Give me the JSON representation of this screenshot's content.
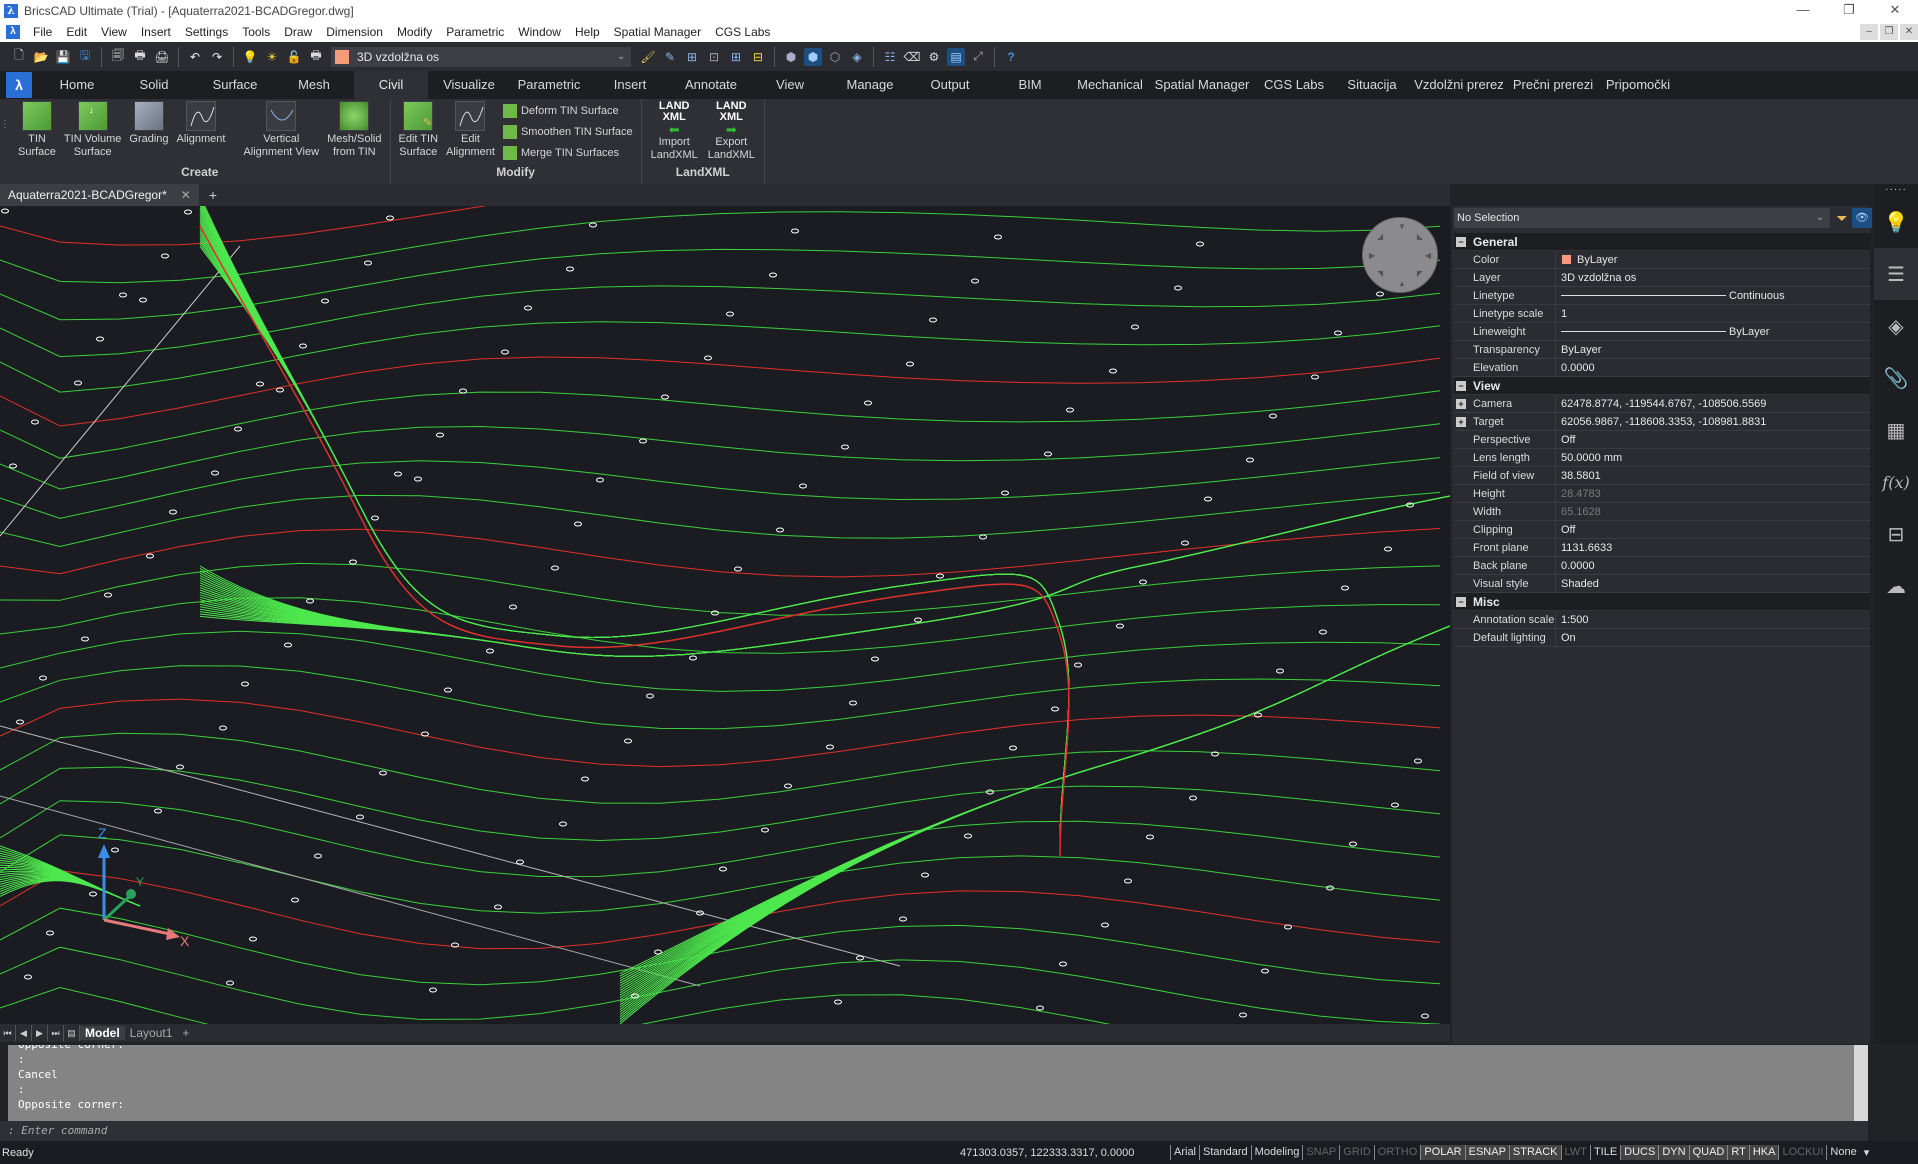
{
  "window": {
    "title": "BricsCAD Ultimate (Trial) - [Aquaterra2021-BCADGregor.dwg]",
    "controls": {
      "minimize": "—",
      "restore": "❐",
      "close": "✕"
    }
  },
  "menubar": {
    "items": [
      "File",
      "Edit",
      "View",
      "Insert",
      "Settings",
      "Tools",
      "Draw",
      "Dimension",
      "Modify",
      "Parametric",
      "Window",
      "Help",
      "Spatial Manager",
      "CGS Labs"
    ],
    "mdi_controls": {
      "minimize": "–",
      "restore": "❐",
      "close": "✕"
    }
  },
  "toolbar": {
    "current_layer": "3D vzdolžna os",
    "layer_color": "#f59a7a",
    "icons": [
      "new-icon",
      "open-icon",
      "save-icon",
      "save-as-icon",
      "print-preview-icon",
      "plot-icon",
      "batch-plot-icon",
      "undo-icon",
      "redo-icon",
      "layer-on-icon",
      "layer-freeze-icon",
      "layer-lock-icon",
      "layer-plot-icon",
      "match-properties-icon",
      "eyedropper-icon",
      "select-icon",
      "select-similar-icon",
      "select-icon-2",
      "select-highlight-icon",
      "view-cube-icon",
      "shaded-icon",
      "wireframe-icon",
      "render-icon",
      "properties-icon",
      "eraser-icon",
      "settings-icon",
      "command-line-icon",
      "fullscreen-icon",
      "help-icon"
    ]
  },
  "ribbon": {
    "logo": "λ",
    "tabs": [
      "Home",
      "Solid",
      "Surface",
      "Mesh",
      "Civil",
      "Visualize",
      "Parametric",
      "Insert",
      "Annotate",
      "View",
      "Manage",
      "Output",
      "BIM",
      "Mechanical",
      "Spatial Manager",
      "CGS Labs",
      "Situacija",
      "Vzdolžni prerez",
      "Prečni prerezi",
      "Pripomočki"
    ],
    "active_tab": "Civil",
    "groups": {
      "create": {
        "label": "Create",
        "buttons": [
          {
            "line1": "TIN",
            "line2": "Surface"
          },
          {
            "line1": "TIN Volume",
            "line2": "Surface"
          },
          {
            "line1": "Grading",
            "line2": ""
          },
          {
            "line1": "Alignment",
            "line2": ""
          },
          {
            "line1": "Vertical",
            "line2": "Alignment View"
          },
          {
            "line1": "Mesh/Solid",
            "line2": "from TIN"
          }
        ]
      },
      "modify": {
        "label": "Modify",
        "buttons": [
          {
            "line1": "Edit TIN",
            "line2": "Surface"
          },
          {
            "line1": "Edit",
            "line2": "Alignment"
          }
        ],
        "small_buttons": [
          "Deform TIN Surface",
          "Smoothen TIN Surface",
          "Merge TIN Surfaces"
        ]
      },
      "landxml": {
        "label": "LandXML",
        "icon_text_1": "LAND",
        "icon_text_2": "XML",
        "buttons": [
          {
            "line1": "Import",
            "line2": "LandXML",
            "arrow": "⬅"
          },
          {
            "line1": "Export",
            "line2": "LandXML",
            "arrow": "➡"
          }
        ]
      }
    }
  },
  "document_tabs": {
    "active": "Aquaterra2021-BCADGregor*",
    "close": "✕",
    "add": "+"
  },
  "viewport": {
    "ucs": {
      "x_label": "X",
      "y_label": "Y",
      "z_label": "Z"
    },
    "navwheel": "navigation-wheel"
  },
  "layout_tabs": {
    "nav": [
      "⏮",
      "◀",
      "▶",
      "⏭",
      "▤"
    ],
    "tabs": [
      "Model",
      "Layout1"
    ],
    "active": "Model",
    "add": "+"
  },
  "command_line": {
    "history": [
      "Opposite corner:",
      ":",
      "Cancel",
      ":",
      "Opposite corner:"
    ],
    "prompt": ": Enter command"
  },
  "statusbar": {
    "status": "Ready",
    "coords": "471303.0357, 122333.3317, 0.0000",
    "toggles": [
      {
        "label": "Arial",
        "state": "text"
      },
      {
        "label": "Standard",
        "state": "text"
      },
      {
        "label": "Modeling",
        "state": "text"
      },
      {
        "label": "SNAP",
        "state": "off"
      },
      {
        "label": "GRID",
        "state": "off"
      },
      {
        "label": "ORTHO",
        "state": "off"
      },
      {
        "label": "POLAR",
        "state": "on"
      },
      {
        "label": "ESNAP",
        "state": "on"
      },
      {
        "label": "STRACK",
        "state": "on"
      },
      {
        "label": "LWT",
        "state": "off"
      },
      {
        "label": "TILE",
        "state": "text"
      },
      {
        "label": "DUCS",
        "state": "on"
      },
      {
        "label": "DYN",
        "state": "on"
      },
      {
        "label": "QUAD",
        "state": "on"
      },
      {
        "label": "RT",
        "state": "on"
      },
      {
        "label": "HKA",
        "state": "on"
      },
      {
        "label": "LOCKUI",
        "state": "off"
      },
      {
        "label": "None",
        "state": "text"
      }
    ],
    "menu_arrow": "▾"
  },
  "properties": {
    "selection": "No Selection",
    "sections": {
      "general": {
        "title": "General",
        "rows": [
          {
            "key": "Color",
            "value": "ByLayer",
            "swatch": "#f59a7a"
          },
          {
            "key": "Layer",
            "value": "3D vzdolžna os"
          },
          {
            "key": "Linetype",
            "value": "Continuous",
            "line": true
          },
          {
            "key": "Linetype scale",
            "value": "1"
          },
          {
            "key": "Lineweight",
            "value": "ByLayer",
            "line": true
          },
          {
            "key": "Transparency",
            "value": "ByLayer"
          },
          {
            "key": "Elevation",
            "value": "0.0000"
          }
        ]
      },
      "view": {
        "title": "View",
        "rows": [
          {
            "key": "Camera",
            "value": "62478.8774, -119544.6767, -108506.5569",
            "expandable": true
          },
          {
            "key": "Target",
            "value": "62056.9867, -118608.3353, -108981.8831",
            "expandable": true
          },
          {
            "key": "Perspective",
            "value": "Off"
          },
          {
            "key": "Lens length",
            "value": "50.0000 mm"
          },
          {
            "key": "Field of view",
            "value": "38.5801"
          },
          {
            "key": "Height",
            "value": "28.4783",
            "dim": true
          },
          {
            "key": "Width",
            "value": "65.1628",
            "dim": true
          },
          {
            "key": "Clipping",
            "value": "Off"
          },
          {
            "key": "Front plane",
            "value": "1131.6633"
          },
          {
            "key": "Back plane",
            "value": "0.0000"
          },
          {
            "key": "Visual style",
            "value": "Shaded"
          }
        ]
      },
      "misc": {
        "title": "Misc",
        "rows": [
          {
            "key": "Annotation scale",
            "value": "1:500"
          },
          {
            "key": "Default lighting",
            "value": "On"
          }
        ]
      }
    }
  },
  "right_panel_icons": [
    "lightbulb-icon",
    "properties-sliders-icon",
    "layers-icon",
    "attachments-icon",
    "drawing-explorer-icon",
    "formula-icon",
    "structure-tree-icon",
    "cloud-upload-icon"
  ],
  "right_panel_glyphs": [
    "💡",
    "☰",
    "◈",
    "📎",
    "▦",
    "f(x)",
    "⊟",
    "☁"
  ],
  "colors": {
    "contour": "#3bd13b",
    "major_contour": "#e0302b",
    "surface_green": "#4ee84e",
    "accent_blue": "#2a6fd6"
  }
}
